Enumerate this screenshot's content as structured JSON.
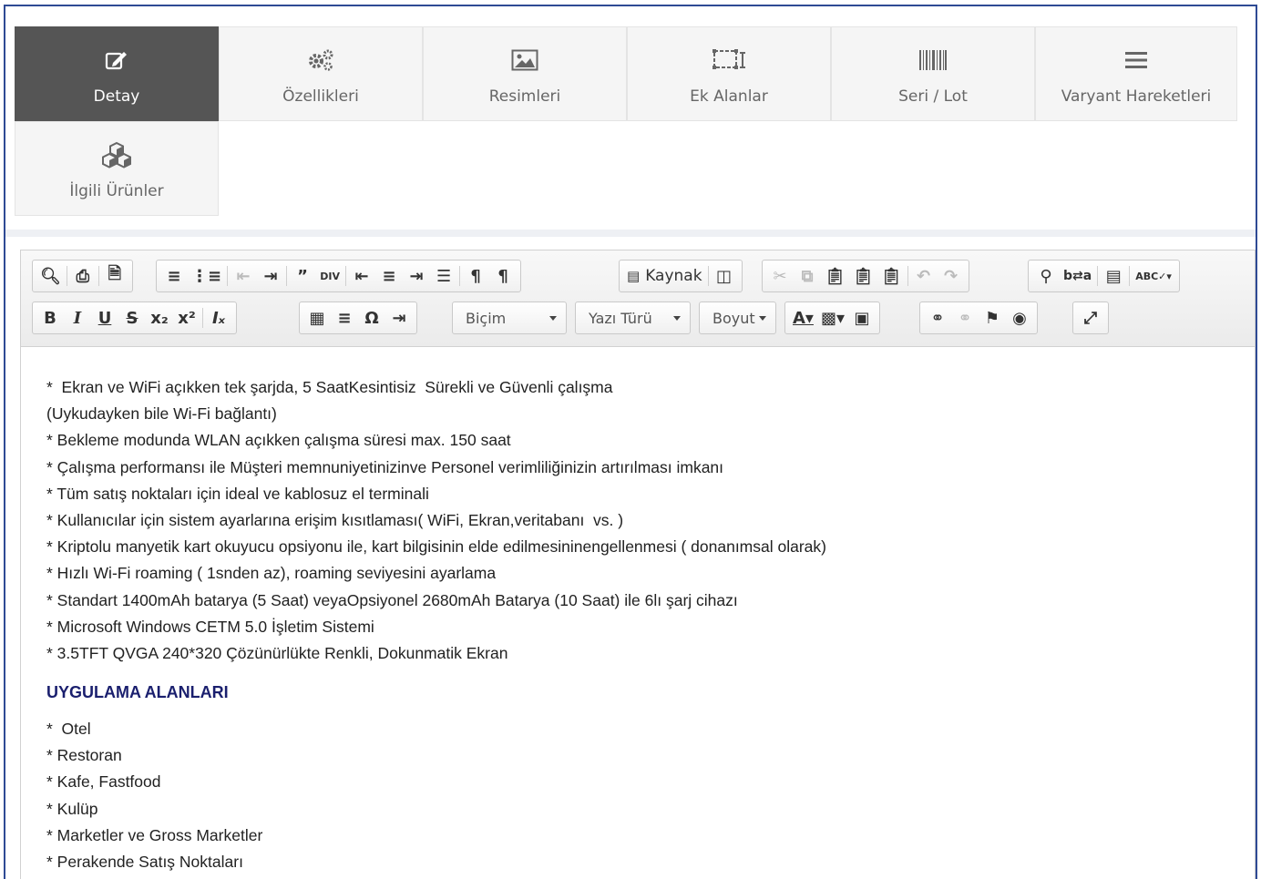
{
  "tabs": [
    {
      "label": "Detay",
      "icon": "edit-icon",
      "active": true
    },
    {
      "label": "Özellikleri",
      "icon": "gears-icon",
      "active": false
    },
    {
      "label": "Resimleri",
      "icon": "image-icon",
      "active": false
    },
    {
      "label": "Ek Alanlar",
      "icon": "custom-fields-icon",
      "active": false
    },
    {
      "label": "Seri / Lot",
      "icon": "barcode-icon",
      "active": false
    },
    {
      "label": "Varyant Hareketleri",
      "icon": "bars-icon",
      "active": false
    },
    {
      "label": "İlgili Ürünler",
      "icon": "cubes-icon",
      "active": false
    }
  ],
  "toolbar": {
    "source_label": "Kaynak",
    "format_combo": "Biçim",
    "font_combo": "Yazı Türü",
    "size_combo": "Boyut"
  },
  "content": {
    "lines": [
      "*  Ekran ve WiFi açıkken tek şarjda, 5 SaatKesintisiz  Sürekli ve Güvenli çalışma",
      "(Uykudayken bile Wi-Fi bağlantı)",
      "* Bekleme modunda WLAN açıkken çalışma süresi max. 150 saat",
      "* Çalışma performansı ile Müşteri memnuniyetinizinve Personel verimliliğinizin artırılması imkanı",
      "* Tüm satış noktaları için ideal ve kablosuz el terminali",
      "* Kullanıcılar için sistem ayarlarına erişim kısıtlaması( WiFi, Ekran,veritabanı  vs. )",
      "* Kriptolu manyetik kart okuyucu opsiyonu ile, kart bilgisinin elde edilmesininengellenmesi ( donanımsal olarak)",
      "* Hızlı Wi-Fi roaming ( 1snden az), roaming seviyesini ayarlama",
      "* Standart 1400mAh batarya (5 Saat) veyaOpsiyonel 2680mAh Batarya (10 Saat) ile 6lı şarj cihazı",
      "* Microsoft Windows CETM 5.0 İşletim Sistemi",
      "* 3.5TFT QVGA 240*320 Çözünürlükte Renkli, Dokunmatik Ekran"
    ],
    "heading": "UYGULAMA ALANLARI",
    "areas": [
      "*  Otel",
      "* Restoran",
      "* Kafe, Fastfood",
      "* Kulüp",
      "* Marketler ve Gross Marketler",
      "* Perakende Satış Noktaları"
    ]
  },
  "colors": {
    "frame": "#2e4a94",
    "active_tab": "#555555",
    "heading": "#1a1f6e"
  }
}
